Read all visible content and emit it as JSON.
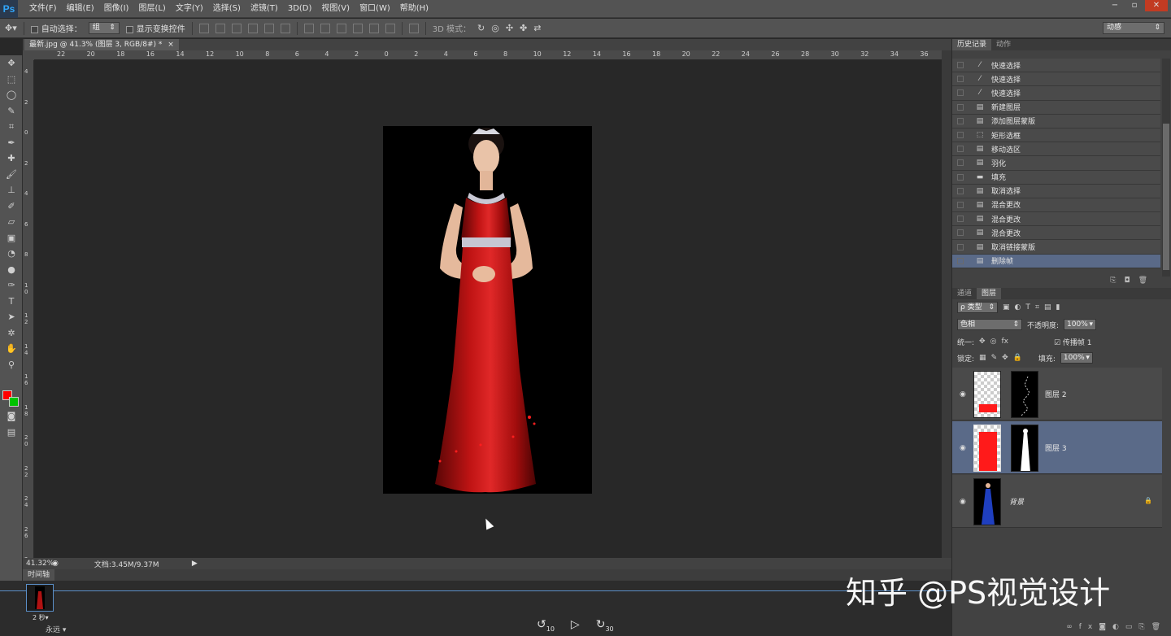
{
  "app": {
    "logo": "Ps"
  },
  "menu": [
    "文件(F)",
    "编辑(E)",
    "图像(I)",
    "图层(L)",
    "文字(Y)",
    "选择(S)",
    "滤镜(T)",
    "3D(D)",
    "视图(V)",
    "窗口(W)",
    "帮助(H)"
  ],
  "window_controls": [
    "−",
    "▫",
    "✕"
  ],
  "options": {
    "auto_select_label": "自动选择：",
    "auto_select_value": "组",
    "show_transform_label": "显示变换控件",
    "mode_3d_label": "3D 模式：",
    "workspace": "动感"
  },
  "document": {
    "tab_title": "最新.jpg @ 41.3% (图层 3, RGB/8#) *",
    "tab_close": "×"
  },
  "ruler_top": [
    "22",
    "20",
    "18",
    "16",
    "14",
    "12",
    "10",
    "8",
    "6",
    "4",
    "2",
    "0",
    "2",
    "4",
    "6",
    "8",
    "10",
    "12",
    "14",
    "16",
    "18",
    "20",
    "22",
    "24",
    "26",
    "28",
    "30",
    "32",
    "34",
    "36"
  ],
  "ruler_left": [
    "4",
    "2",
    "0",
    "2",
    "4",
    "6",
    "8",
    "1 0",
    "1 2",
    "1 4",
    "1 6",
    "1 8",
    "2 0",
    "2 2",
    "2 4",
    "2 6",
    "2 8"
  ],
  "status": {
    "zoom": "41.32%",
    "doc": "文档:3.45M/9.37M"
  },
  "timeline": {
    "tab": "时间轴",
    "frame_duration": "2 秒▾",
    "loop": "永远",
    "back10": "10",
    "fwd30": "30"
  },
  "history_panel": {
    "tabs": [
      "历史记录",
      "动作"
    ],
    "items": [
      {
        "icon": "brush",
        "label": "快速选择"
      },
      {
        "icon": "brush",
        "label": "快速选择"
      },
      {
        "icon": "brush",
        "label": "快速选择"
      },
      {
        "icon": "doc",
        "label": "新建图层"
      },
      {
        "icon": "doc",
        "label": "添加图层蒙版"
      },
      {
        "icon": "marquee",
        "label": "矩形选框"
      },
      {
        "icon": "doc",
        "label": "移动选区"
      },
      {
        "icon": "doc",
        "label": "羽化"
      },
      {
        "icon": "fill",
        "label": "填充"
      },
      {
        "icon": "doc",
        "label": "取消选择"
      },
      {
        "icon": "doc",
        "label": "混合更改"
      },
      {
        "icon": "doc",
        "label": "混合更改"
      },
      {
        "icon": "doc",
        "label": "混合更改"
      },
      {
        "icon": "doc",
        "label": "取消链接蒙版"
      },
      {
        "icon": "doc",
        "label": "删除帧"
      }
    ],
    "active_index": 14
  },
  "layers_panel": {
    "tabs": [
      "通道",
      "图层"
    ],
    "filter": "ρ 类型",
    "blend_mode": "色相",
    "opacity_label": "不透明度:",
    "opacity_value": "100%",
    "unify_label": "统一:",
    "propagate_label": "传播帧 1",
    "lock_label": "锁定:",
    "fill_label": "填充:",
    "fill_value": "100%",
    "layers": [
      {
        "name": "图层 2",
        "active": false
      },
      {
        "name": "图层 3",
        "active": true
      },
      {
        "name": "背景",
        "active": false,
        "locked": true
      }
    ]
  },
  "watermark": "知乎 @PS视觉设计",
  "colors": {
    "foreground": "#ff0000",
    "background": "#00c400",
    "selection": "#5a6a88"
  }
}
